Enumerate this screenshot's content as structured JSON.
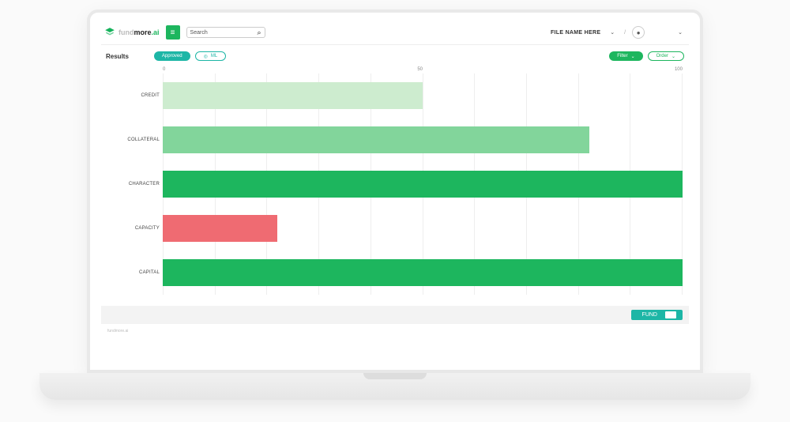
{
  "brand": {
    "primary": "fund",
    "strong": "more",
    "suffix": ".ai"
  },
  "search": {
    "label": "Search"
  },
  "header": {
    "file_label": "FILE NAME HERE"
  },
  "toolbar": {
    "title": "Results",
    "approved_label": "Approved",
    "ml_label": "ML",
    "filter_label": "Filter",
    "order_label": "Order"
  },
  "fund": {
    "label": "FUND"
  },
  "footer": {
    "text": "fundmore.ai"
  },
  "chart_data": {
    "type": "bar",
    "orientation": "horizontal",
    "xlim": [
      0,
      100
    ],
    "ticks": [
      0,
      50,
      100
    ],
    "categories": [
      "CREDIT",
      "COLLATERAL",
      "CHARACTER",
      "CAPACITY",
      "CAPITAL"
    ],
    "values": [
      50,
      82,
      100,
      22,
      100
    ],
    "colors": [
      "#cdeccf",
      "#82d59b",
      "#1db65e",
      "#ef6b72",
      "#1db65e"
    ]
  }
}
